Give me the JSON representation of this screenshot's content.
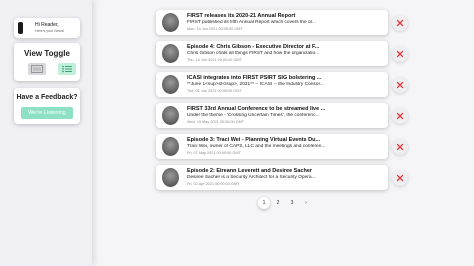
{
  "greeting": {
    "line1": "Hi Reader,",
    "line2": "Here's your News!"
  },
  "view_toggle": {
    "title": "View Toggle",
    "selected": "list"
  },
  "feedback": {
    "title": "Have a Feedback?",
    "button_label": "We're Listening"
  },
  "items": [
    {
      "title": "FIRST releases its 2020-21 Annual Report",
      "summary": "FIRST published its fifth Annual Report which covers the or...",
      "date": "Mon, 14 Jun 2021 00:00:00 GMT"
    },
    {
      "title": "Episode 4: Chris Gibson - Executive Director at F...",
      "summary": "Chris Gibson chats all things FIRST and how the organizatio...",
      "date": "Thu, 10 Jun 2021 00:00:00 GMT"
    },
    {
      "title": "ICASI integrates into FIRST PSIRT SIG bolstering ...",
      "summary": "**June 1<sup>st</sup>, 2021** -- ICASI -- the Industry Consor...",
      "date": "Tue, 01 Jun 2021 00:00:00 GMT"
    },
    {
      "title": "FIRST 33rd Annual Conference to be streamed live ...",
      "summary": "Under the theme - 'Crossing Uncertain Times', the conferenc...",
      "date": "Wed, 19 May 2021 00:00:00 GMT"
    },
    {
      "title": "Episode 3: Traci Wei - Planning Virtual Events Du...",
      "summary": "Traci Wei, owner of CAPS, LLC and the meetings and conferen...",
      "date": "Fri, 07 May 2021 00:00:00 GMT"
    },
    {
      "title": "Episode 2: Eireann Leverett and Desiree Sacher",
      "summary": "Desiree Sacher is a Security Architect for a Security Opera...",
      "date": "Fri, 02 Apr 2021 00:00:00 GMT"
    }
  ],
  "pagination": {
    "pages": [
      "1",
      "2",
      "3"
    ],
    "next_symbol": "›",
    "current": "1"
  }
}
